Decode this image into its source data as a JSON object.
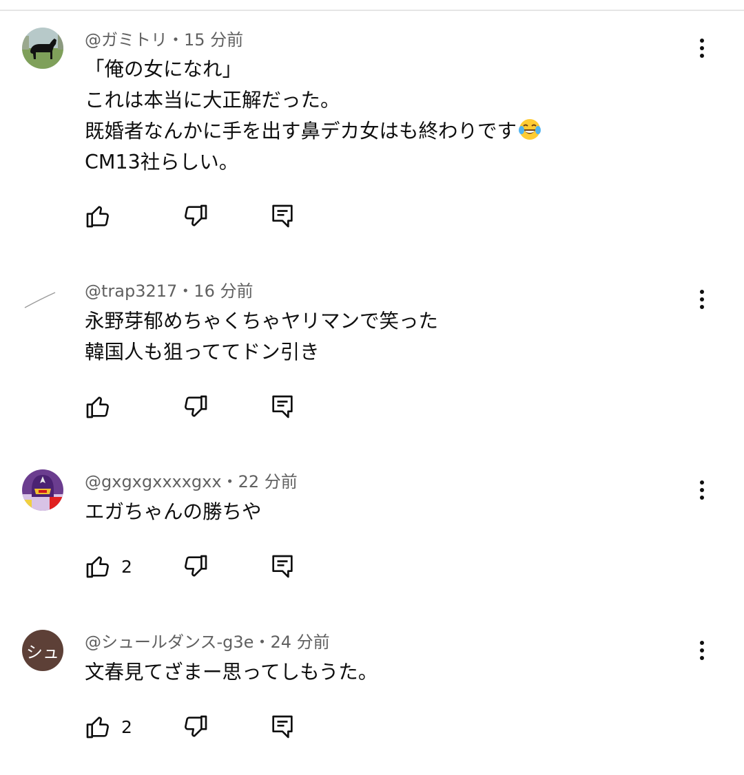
{
  "comments": [
    {
      "author": "@ガミトリ",
      "separator": "・",
      "time": "15 分前",
      "lines": [
        "「俺の女になれ」",
        "これは本当に大正解だった。",
        "既婚者なんかに手を出す鼻デカ女はも終わりです",
        "CM13社らしい。"
      ],
      "emoji_icon": "face-with-tears-of-joy-icon",
      "avatar_icon": "black-horse-photo-avatar",
      "likes": ""
    },
    {
      "author": "@trap3217",
      "separator": "・",
      "time": "16 分前",
      "lines": [
        "永野芽郁めちゃくちゃヤリマンで笑った",
        "韓国人も狙っててドン引き"
      ],
      "avatar_icon": "line-sketch-avatar",
      "likes": ""
    },
    {
      "author": "@gxgxgxxxxgxx",
      "separator": "・",
      "time": "22 分前",
      "lines": [
        "エガちゃんの勝ちや"
      ],
      "avatar_icon": "purple-helmet-character-avatar",
      "likes": "2"
    },
    {
      "author": "@シュールダンス-g3e",
      "separator": "・",
      "time": "24 分前",
      "lines": [
        "文春見てざまー思ってしもうた。"
      ],
      "avatar_text": "シュ",
      "avatar_color": "#5d4037",
      "likes": "2"
    }
  ],
  "icons": {
    "like": "thumb-up-icon",
    "dislike": "thumb-down-icon",
    "reply": "reply-comment-icon",
    "more": "more-vertical-icon"
  }
}
